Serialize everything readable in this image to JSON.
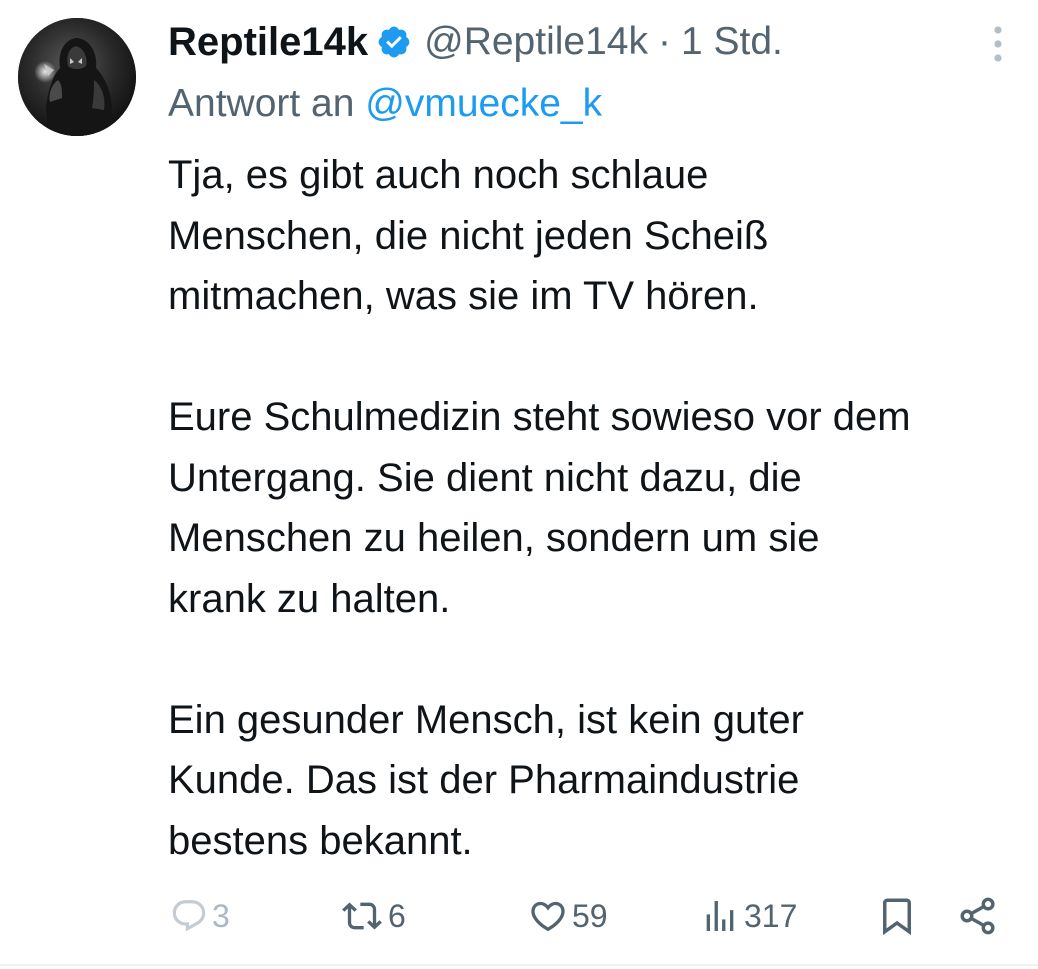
{
  "author": {
    "display_name": "Reptile14k",
    "handle": "@Reptile14k",
    "separator": "·",
    "time": "1 Std.",
    "verified": true
  },
  "reply": {
    "prefix": "Antwort an",
    "mention": "@vmuecke_k"
  },
  "body": {
    "paragraphs": [
      "Tja, es gibt auch noch schlaue\nMenschen, die nicht jeden Scheiß\nmitmachen, was sie im TV hören.",
      "Eure Schulmedizin steht sowieso vor dem\nUntergang. Sie dient nicht dazu, die\nMenschen zu heilen, sondern um sie\nkrank zu halten.",
      "Ein gesunder Mensch, ist kein guter\nKunde. Das ist der Pharmaindustrie\nbestens bekannt."
    ]
  },
  "actions": {
    "replies": "3",
    "reposts": "6",
    "likes": "59",
    "views": "317"
  },
  "icons": {
    "verified": "verified-badge-icon",
    "more": "more-vertical-icon",
    "reply": "reply-bubble-icon",
    "repost": "repost-icon",
    "like": "heart-icon",
    "views": "views-bar-chart-icon",
    "bookmark": "bookmark-icon",
    "share": "share-icon"
  },
  "colors": {
    "text": "#0f1419",
    "secondary": "#536471",
    "accent": "#1d9bf0",
    "reply_count_faded": "#aab8c2"
  }
}
